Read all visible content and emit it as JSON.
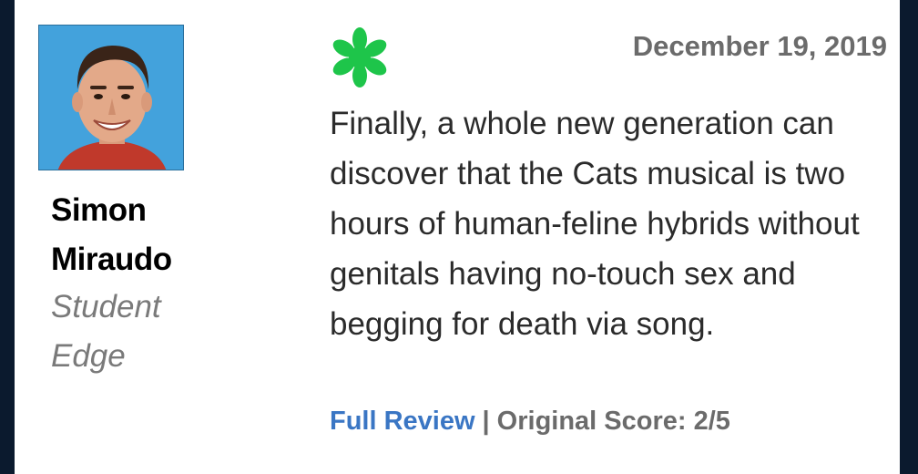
{
  "critic": {
    "name": "Simon Miraudo",
    "publication": "Student Edge"
  },
  "review": {
    "date": "December 19, 2019",
    "text": "Finally, a whole new generation can discover that the Cats musical is two hours of human-feline hybrids without genitals having no-touch sex and begging for death via song.",
    "full_review_label": "Full Review",
    "separator": "|",
    "original_score": "Original Score: 2/5"
  },
  "icons": {
    "rating_icon": "fresh-splat-icon",
    "avatar": "critic-avatar"
  },
  "colors": {
    "background": "#0b1a2e",
    "card": "#ffffff",
    "fresh_green": "#1ec54a",
    "link_blue": "#3a76c4",
    "muted_gray": "#6b6b6b"
  }
}
